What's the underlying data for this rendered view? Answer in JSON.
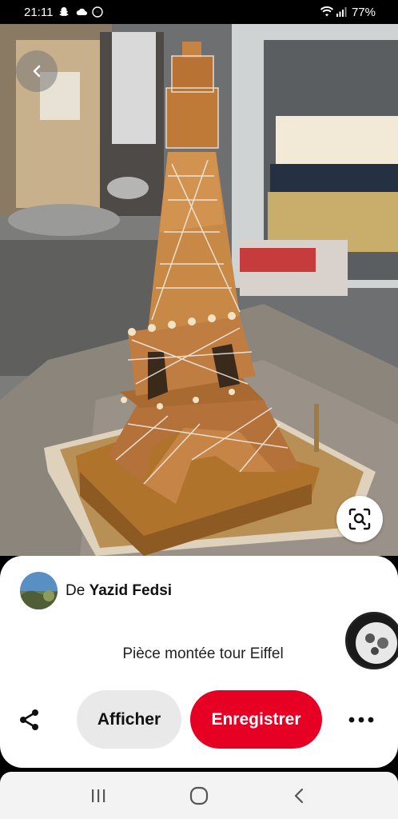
{
  "status_bar": {
    "time": "21:11",
    "battery": "77%",
    "icons_left": [
      "snapchat-icon",
      "cloud-icon",
      "messenger-icon"
    ],
    "icons_right": [
      "wifi-icon",
      "signal-icon"
    ]
  },
  "pin": {
    "image_alt": "photo-of-gingerbread-eiffel-tower",
    "creator_prefix": "De",
    "creator_name": "Yazid Fedsi",
    "title": "Pièce montée tour Eiffel"
  },
  "actions": {
    "afficher_label": "Afficher",
    "enregistrer_label": "Enregistrer"
  },
  "colors": {
    "save_red": "#e60023",
    "secondary_gray": "#e9e9e9"
  }
}
